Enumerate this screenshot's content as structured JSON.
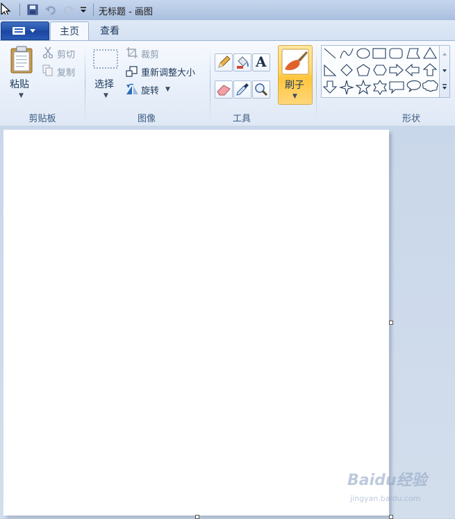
{
  "window": {
    "title": "无标题 - 画图"
  },
  "tabs": [
    {
      "label": "主页",
      "active": true
    },
    {
      "label": "查看",
      "active": false
    }
  ],
  "clipboard": {
    "paste_label": "粘贴",
    "cut_label": "剪切",
    "copy_label": "复制",
    "group_label": "剪贴板"
  },
  "image": {
    "select_label": "选择",
    "crop_label": "裁剪",
    "resize_label": "重新调整大小",
    "rotate_label": "旋转",
    "group_label": "图像"
  },
  "tools": {
    "group_label": "工具",
    "items": [
      "pencil-icon",
      "fill-icon",
      "text-icon",
      "eraser-icon",
      "color-picker-icon",
      "magnifier-icon"
    ],
    "text_glyph": "A"
  },
  "brushes": {
    "label": "刷子"
  },
  "shapes": {
    "group_label": "形状",
    "items": [
      "line-shape",
      "curve-shape",
      "oval-shape",
      "rectangle-shape",
      "rounded-rectangle-shape",
      "polygon-shape",
      "triangle-shape",
      "right-triangle-shape",
      "diamond-shape",
      "pentagon-shape",
      "hexagon-shape",
      "right-arrow-shape",
      "left-arrow-shape",
      "up-arrow-shape",
      "down-arrow-shape",
      "four-point-star-shape",
      "five-point-star-shape",
      "six-point-star-shape",
      "rect-callout-shape",
      "oval-callout-shape",
      "cloud-callout-shape"
    ]
  },
  "watermark": {
    "brand": "Baidu经验",
    "url": "jingyan.baidu.com"
  },
  "colors": {
    "accent": "#1f4fa8",
    "canvas": "#ffffff",
    "brush_highlight": "#ffd66b"
  }
}
